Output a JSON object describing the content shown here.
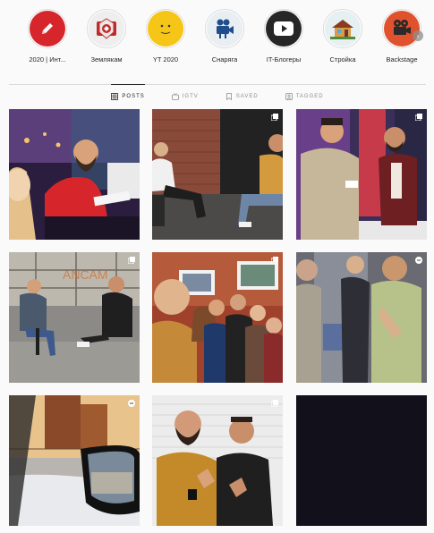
{
  "highlights": [
    {
      "label": "2020 | Инт...",
      "icon": "pencil-icon",
      "color": "#d6262c"
    },
    {
      "label": "Землякам",
      "icon": "emblem-icon",
      "color": "#c42a2a"
    },
    {
      "label": "YT 2020",
      "icon": "yellow-dot-icon",
      "color": "#f5c518"
    },
    {
      "label": "Снаряга",
      "icon": "camera-icon",
      "color": "#1f4e8c"
    },
    {
      "label": "IT-Блогеры",
      "icon": "play-icon",
      "color": "#262626"
    },
    {
      "label": "Стройка",
      "icon": "house-icon",
      "color": "#8a5a2b"
    },
    {
      "label": "Backstage",
      "icon": "movie-camera-icon",
      "color": "#e0512d"
    }
  ],
  "tabs": [
    {
      "label": "POSTS",
      "icon": "grid-icon",
      "active": true
    },
    {
      "label": "IGTV",
      "icon": "tv-icon",
      "active": false
    },
    {
      "label": "SAVED",
      "icon": "bookmark-icon",
      "active": false
    },
    {
      "label": "TAGGED",
      "icon": "tag-icon",
      "active": false
    }
  ],
  "posts": [
    {
      "name": "post-interview-red-hoodie",
      "badge": "none"
    },
    {
      "name": "post-studio-interview-brick",
      "badge": "multiple-photos-icon"
    },
    {
      "name": "post-two-men-talking",
      "badge": "multiple-photos-icon"
    },
    {
      "name": "post-interview-loft",
      "badge": "multiple-photos-icon"
    },
    {
      "name": "post-group-selfie",
      "badge": "multiple-photos-icon"
    },
    {
      "name": "post-people-blurred",
      "badge": "video-icon"
    },
    {
      "name": "post-car-mirror-winter",
      "badge": "video-icon"
    },
    {
      "name": "post-two-men-thumbs-up",
      "badge": "multiple-photos-icon"
    },
    {
      "name": "post-dark-video",
      "badge": "none"
    }
  ]
}
